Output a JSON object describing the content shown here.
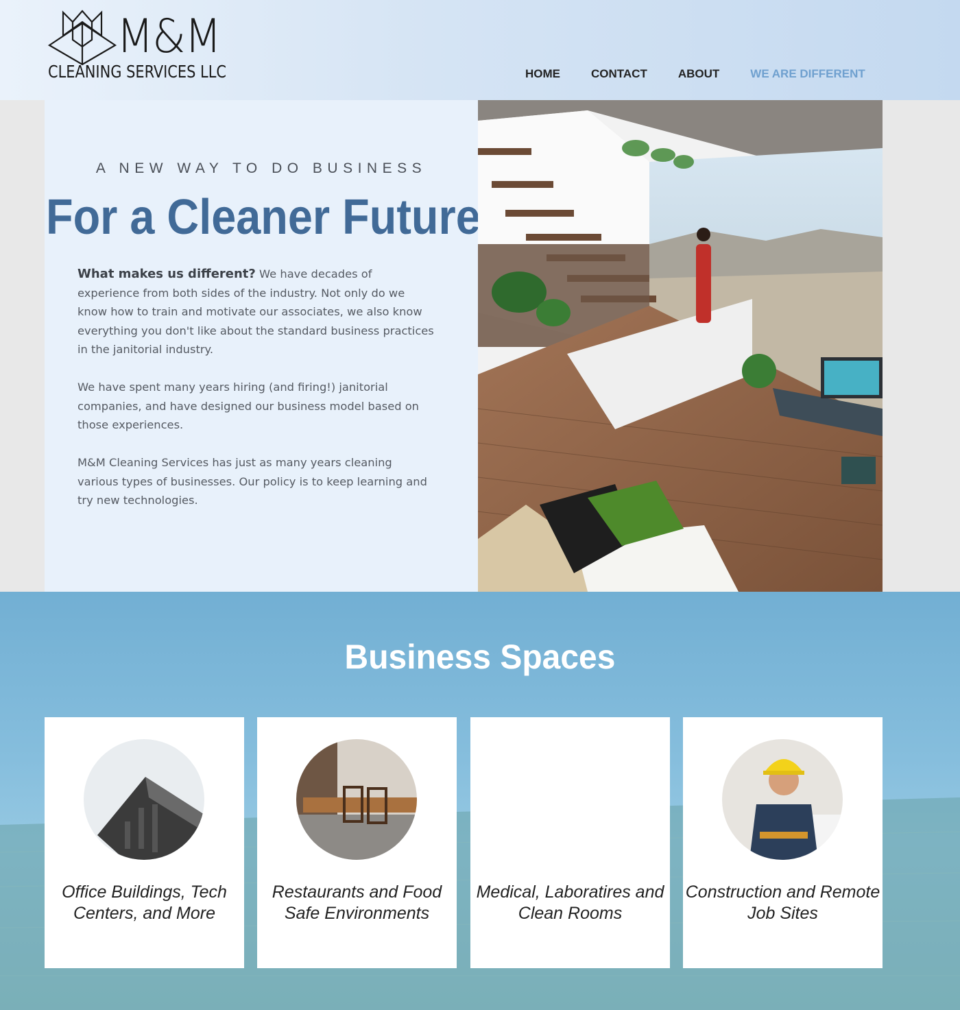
{
  "brand": {
    "logo_mm": "M&M",
    "logo_sub": "CLEANING SERVICES LLC"
  },
  "nav": {
    "items": [
      {
        "label": "HOME"
      },
      {
        "label": "CONTACT"
      },
      {
        "label": "ABOUT"
      },
      {
        "label": "WE ARE DIFFERENT",
        "active": true
      }
    ]
  },
  "hero": {
    "tagline": "A NEW WAY TO DO BUSINESS",
    "title": "For a Cleaner Future",
    "lead_bold": "What makes us different?",
    "lead_text": " We have decades of experience from both sides of the industry. Not only do we know how to train and motivate our associates, we also know everything you don't like about the standard business practices in the janitorial industry.",
    "p2": "We have spent many years hiring (and firing!) janitorial companies, and have designed our business model based on those experiences.",
    "p3": "M&M Cleaning Services has just as many years cleaning various types of businesses. Our policy is to keep learning and try new technologies."
  },
  "spaces": {
    "title": "Business Spaces",
    "cards": [
      {
        "label": "Office Buildings, Tech Centers, and More",
        "icon": "building-photo"
      },
      {
        "label": "Restaurants and Food Safe Environments",
        "icon": "restaurant-photo"
      },
      {
        "label": "Medical, Laboratires and Clean Rooms",
        "icon": "blank"
      },
      {
        "label": "Construction and Remote Job Sites",
        "icon": "construction-worker-photo"
      }
    ]
  },
  "colors": {
    "accent": "#416a97",
    "nav_active": "#6fa0cf",
    "section_bg": "#7fb8da"
  }
}
